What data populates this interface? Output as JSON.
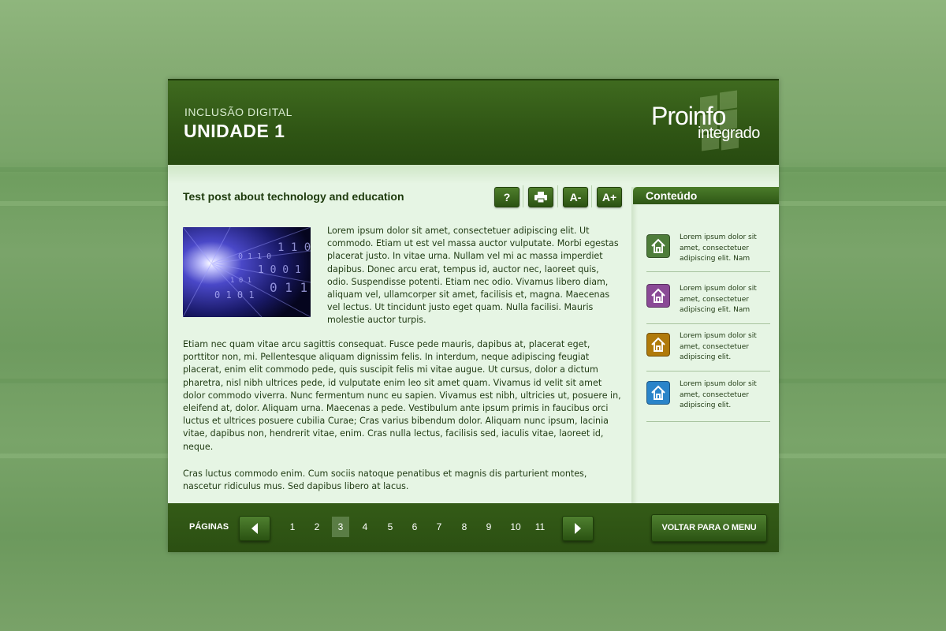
{
  "header": {
    "subtitle": "INCLUSÃO DIGITAL",
    "title": "UNIDADE 1",
    "logo_main": "Proinfo",
    "logo_sub": "integrado"
  },
  "post": {
    "title": "Test post about technology and education",
    "paragraphs": [
      "Lorem ipsum dolor sit amet, consectetuer adipiscing elit. Ut commodo. Etiam ut est vel massa auctor vulputate. Morbi egestas placerat justo. In vitae urna. Nullam vel mi ac massa imperdiet dapibus. Donec arcu erat, tempus id, auctor nec, laoreet quis, odio. Suspendisse potenti. Etiam nec odio. Vivamus libero diam, aliquam vel, ullamcorper sit amet, facilisis et, magna. Maecenas vel lectus. Ut tincidunt justo eget quam. Nulla facilisi. Mauris molestie auctor turpis.",
      "Etiam nec quam vitae arcu sagittis consequat. Fusce pede mauris, dapibus at, placerat eget, porttitor non, mi. Pellentesque aliquam dignissim felis. In interdum, neque adipiscing feugiat placerat, enim elit commodo pede, quis suscipit felis mi vitae augue. Ut cursus, dolor a dictum pharetra, nisl nibh ultrices pede, id vulputate enim leo sit amet quam. Vivamus id velit sit amet dolor commodo viverra. Nunc fermentum nunc eu sapien. Vivamus est nibh, ultricies ut, posuere in, eleifend at, dolor. Aliquam urna. Maecenas a pede. Vestibulum ante ipsum primis in faucibus orci luctus et ultrices posuere cubilia Curae; Cras varius bibendum dolor. Aliquam nunc ipsum, lacinia vitae, dapibus non, hendrerit vitae, enim. Cras nulla lectus, facilisis sed, iaculis vitae, laoreet id, neque.",
      "Cras luctus commodo enim. Cum sociis natoque penatibus et magnis dis parturient montes, nascetur ridiculus mus. Sed dapibus libero at lacus."
    ]
  },
  "toolbar": {
    "help_label": "?",
    "print_icon": "printer-icon",
    "font_decrease_label": "A-",
    "font_increase_label": "A+"
  },
  "sidebar": {
    "title": "Conteúdo",
    "items": [
      {
        "text": "Lorem ipsum dolor sit amet, consectetuer adipiscing elit. Nam",
        "icon": "home-icon",
        "color": "#4e7d3a"
      },
      {
        "text": "Lorem ipsum dolor sit amet, consectetuer adipiscing elit. Nam",
        "icon": "home-icon",
        "color": "#8a4a96"
      },
      {
        "text": "Lorem ipsum dolor sit amet, consectetuer adipiscing elit.",
        "icon": "home-icon",
        "color": "#b07a0a"
      },
      {
        "text": "Lorem ipsum dolor sit amet, consectetuer adipiscing elit.",
        "icon": "home-icon",
        "color": "#2a84c9"
      }
    ]
  },
  "footer": {
    "pages_label": "PÁGINAS",
    "pages": [
      "1",
      "2",
      "3",
      "4",
      "5",
      "6",
      "7",
      "8",
      "9",
      "10",
      "11"
    ],
    "current_page": "3",
    "menu_button": "VOLTAR PARA O MENU"
  },
  "colors": {
    "header_bg": "#2f5514",
    "content_bg": "#e6f5e4",
    "text": "#1f3a12",
    "active_page": "#5a7d45"
  }
}
